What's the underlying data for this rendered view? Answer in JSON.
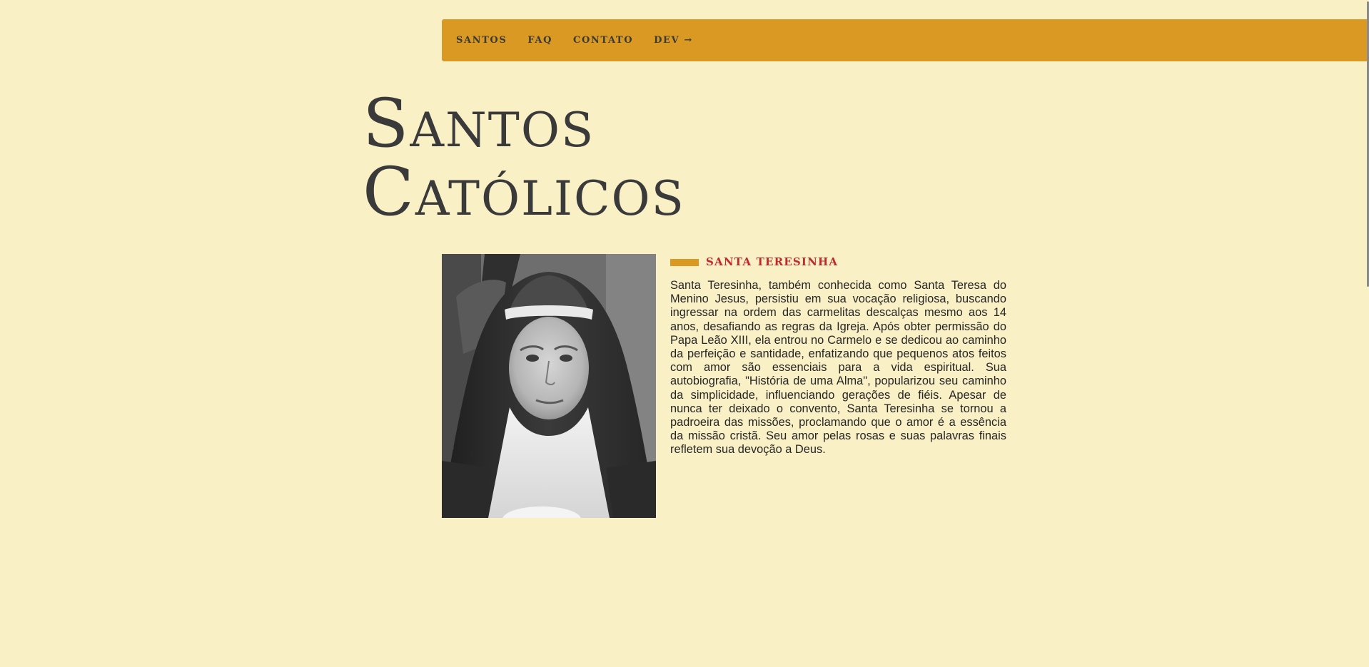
{
  "nav": {
    "items": [
      {
        "label": "SANTOS"
      },
      {
        "label": "FAQ"
      },
      {
        "label": "CONTATO"
      },
      {
        "label": "DEV →"
      }
    ]
  },
  "page": {
    "title_line1": "Santos",
    "title_line2": "Católicos"
  },
  "saint": {
    "name": "SANTA TERESINHA",
    "photo_alt": "Santa Teresinha",
    "description": "Santa Teresinha, também conhecida como Santa Teresa do Menino Jesus, persistiu em sua vocação religiosa, buscando ingressar na ordem das carmelitas descalças mesmo aos 14 anos, desafiando as regras da Igreja. Após obter permissão do Papa Leão XIII, ela entrou no Carmelo e se dedicou ao caminho da perfeição e santidade, enfatizando que pequenos atos feitos com amor são essenciais para a vida espiritual. Sua autobiografia, \"História de uma Alma\", popularizou seu caminho da simplicidade, influenciando gerações de fiéis. Apesar de nunca ter deixado o convento, Santa Teresinha se tornou a padroeira das missões, proclamando que o amor é a essência da missão cristã. Seu amor pelas rosas e suas palavras finais refletem sua devoção a Deus."
  },
  "colors": {
    "background": "#faf0c6",
    "nav_background": "#d99922",
    "accent": "#d99922",
    "heading_red": "#c0282c",
    "text_dark": "#3a3a3a"
  }
}
